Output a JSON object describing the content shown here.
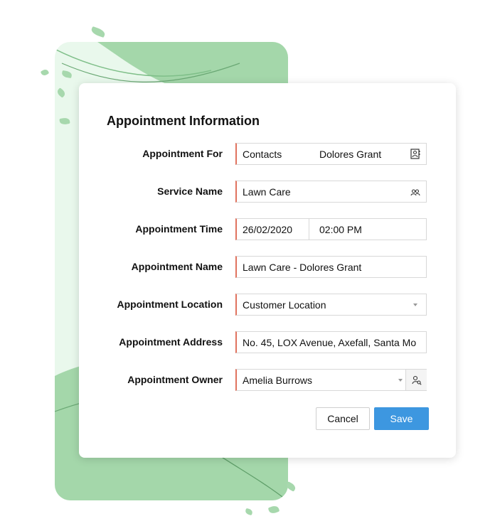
{
  "form": {
    "title": "Appointment Information",
    "appointment_for": {
      "label": "Appointment For",
      "module": "Contacts",
      "value": "Dolores Grant"
    },
    "service_name": {
      "label": "Service Name",
      "value": "Lawn Care"
    },
    "appointment_time": {
      "label": "Appointment Time",
      "date": "26/02/2020",
      "time": "02:00 PM"
    },
    "appointment_name": {
      "label": "Appointment Name",
      "value": "Lawn Care - Dolores Grant"
    },
    "appointment_location": {
      "label": "Appointment Location",
      "value": "Customer Location"
    },
    "appointment_address": {
      "label": "Appointment Address",
      "value": "No. 45, LOX Avenue, Axefall, Santa Mo"
    },
    "appointment_owner": {
      "label": "Appointment Owner",
      "value": "Amelia Burrows"
    },
    "cancel_label": "Cancel",
    "save_label": "Save"
  },
  "icons": {
    "contact_lookup": "contact-card-icon",
    "service_lookup": "users-icon",
    "owner_lookup": "user-search-icon",
    "location_dropdown": "chevron-down-icon",
    "owner_dropdown": "chevron-down-icon"
  },
  "colors": {
    "accent_required": "#e0735f",
    "save_button": "#3d97e0",
    "decor_green": "#a7d8ad"
  }
}
